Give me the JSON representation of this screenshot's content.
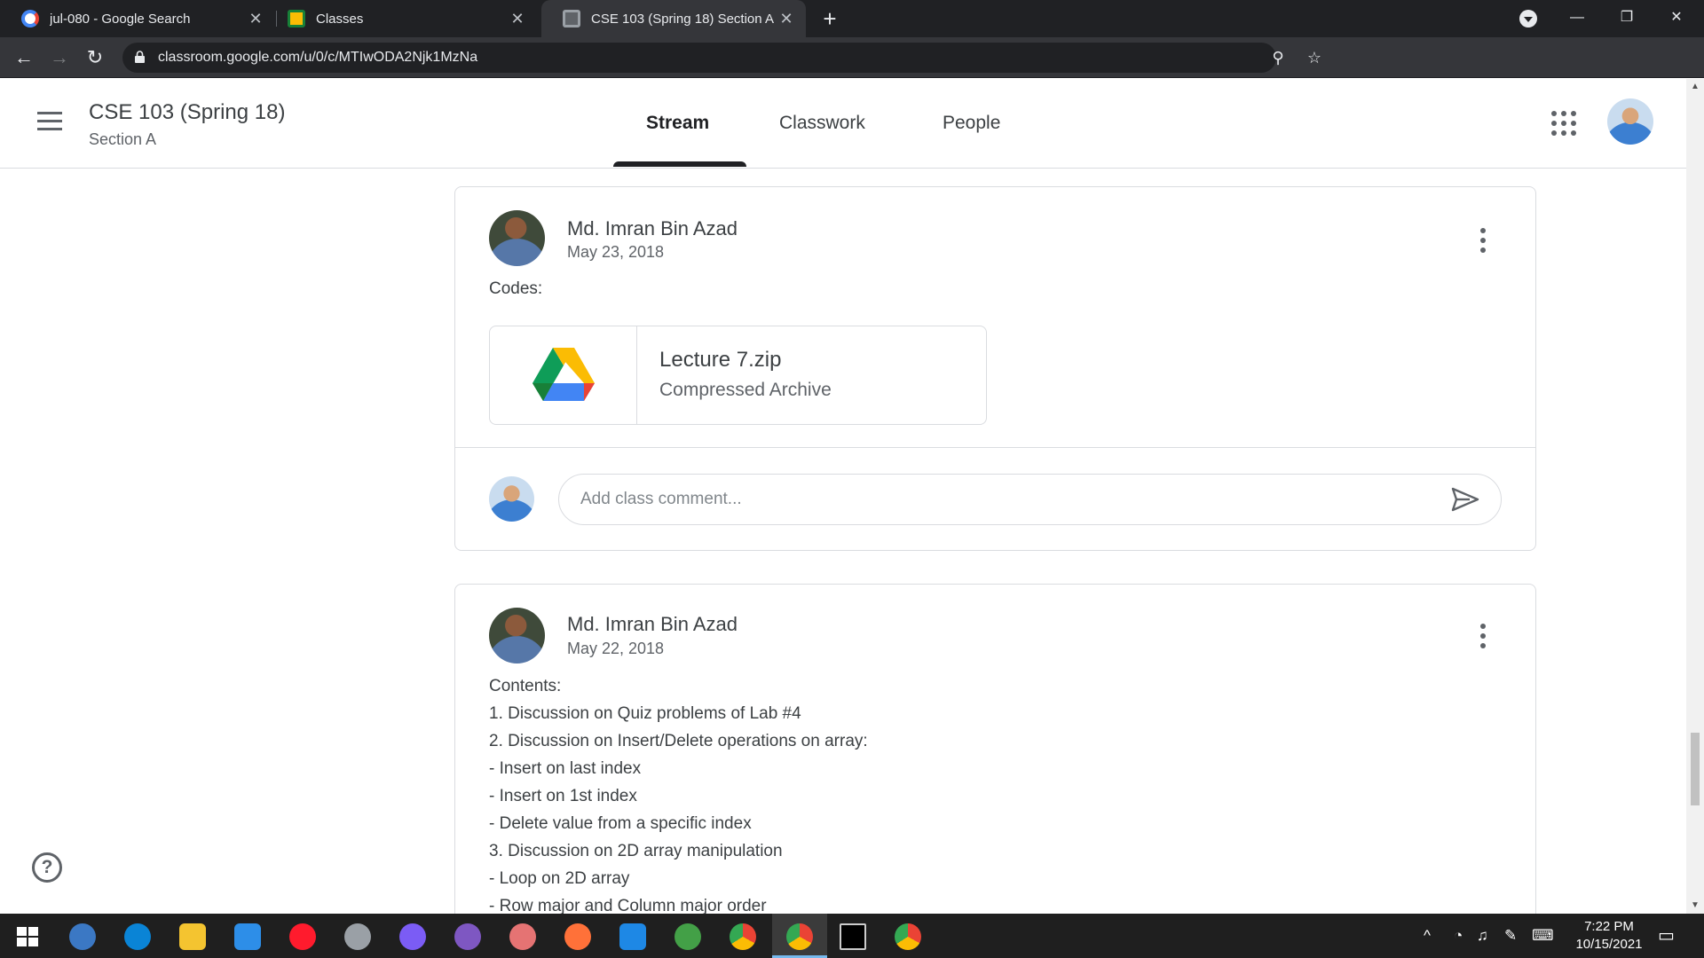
{
  "browser": {
    "tabs": [
      {
        "title": "jul-080 - Google Search",
        "icon": "google-icon",
        "active": false
      },
      {
        "title": "Classes",
        "icon": "classroom-icon",
        "active": false
      },
      {
        "title": "CSE 103 (Spring 18) Section A",
        "icon": "classroom-icon",
        "active": true
      }
    ],
    "url": "classroom.google.com/u/0/c/MTIwODA2Njk1MzNa",
    "extensions": [
      "grammarly-icon",
      "screenshot-icon",
      "ext-icon",
      "play-icon",
      "download-icon",
      "ext-icon",
      "pen-icon",
      "puzzle-icon",
      "profile-avatar"
    ]
  },
  "header": {
    "class_title": "CSE 103 (Spring 18)",
    "class_section": "Section A",
    "tabs": [
      "Stream",
      "Classwork",
      "People"
    ],
    "active_tab": "Stream"
  },
  "posts": [
    {
      "author": "Md. Imran Bin Azad",
      "date": "May 23, 2018",
      "text": "Codes:",
      "attachment": {
        "title": "Lecture 7.zip",
        "type": "Compressed Archive"
      },
      "comment_placeholder": "Add class comment..."
    },
    {
      "author": "Md. Imran Bin Azad",
      "date": "May 22, 2018",
      "lines": [
        "Contents:",
        "1. Discussion on Quiz problems of Lab #4",
        "2. Discussion on Insert/Delete operations on array:",
        "- Insert on last index",
        "- Insert on 1st index",
        "- Delete value from a specific index",
        "3. Discussion on 2D array manipulation",
        "- Loop on 2D array",
        "- Row major and Column major order"
      ]
    }
  ],
  "help_label": "?",
  "taskbar": {
    "time": "7:22 PM",
    "date": "10/15/2021"
  },
  "colors": {
    "chrome_dark": "#202124",
    "chrome_toolbar": "#35363a",
    "text_primary": "#3c4043",
    "text_secondary": "#5f6368",
    "border": "#dadce0"
  }
}
